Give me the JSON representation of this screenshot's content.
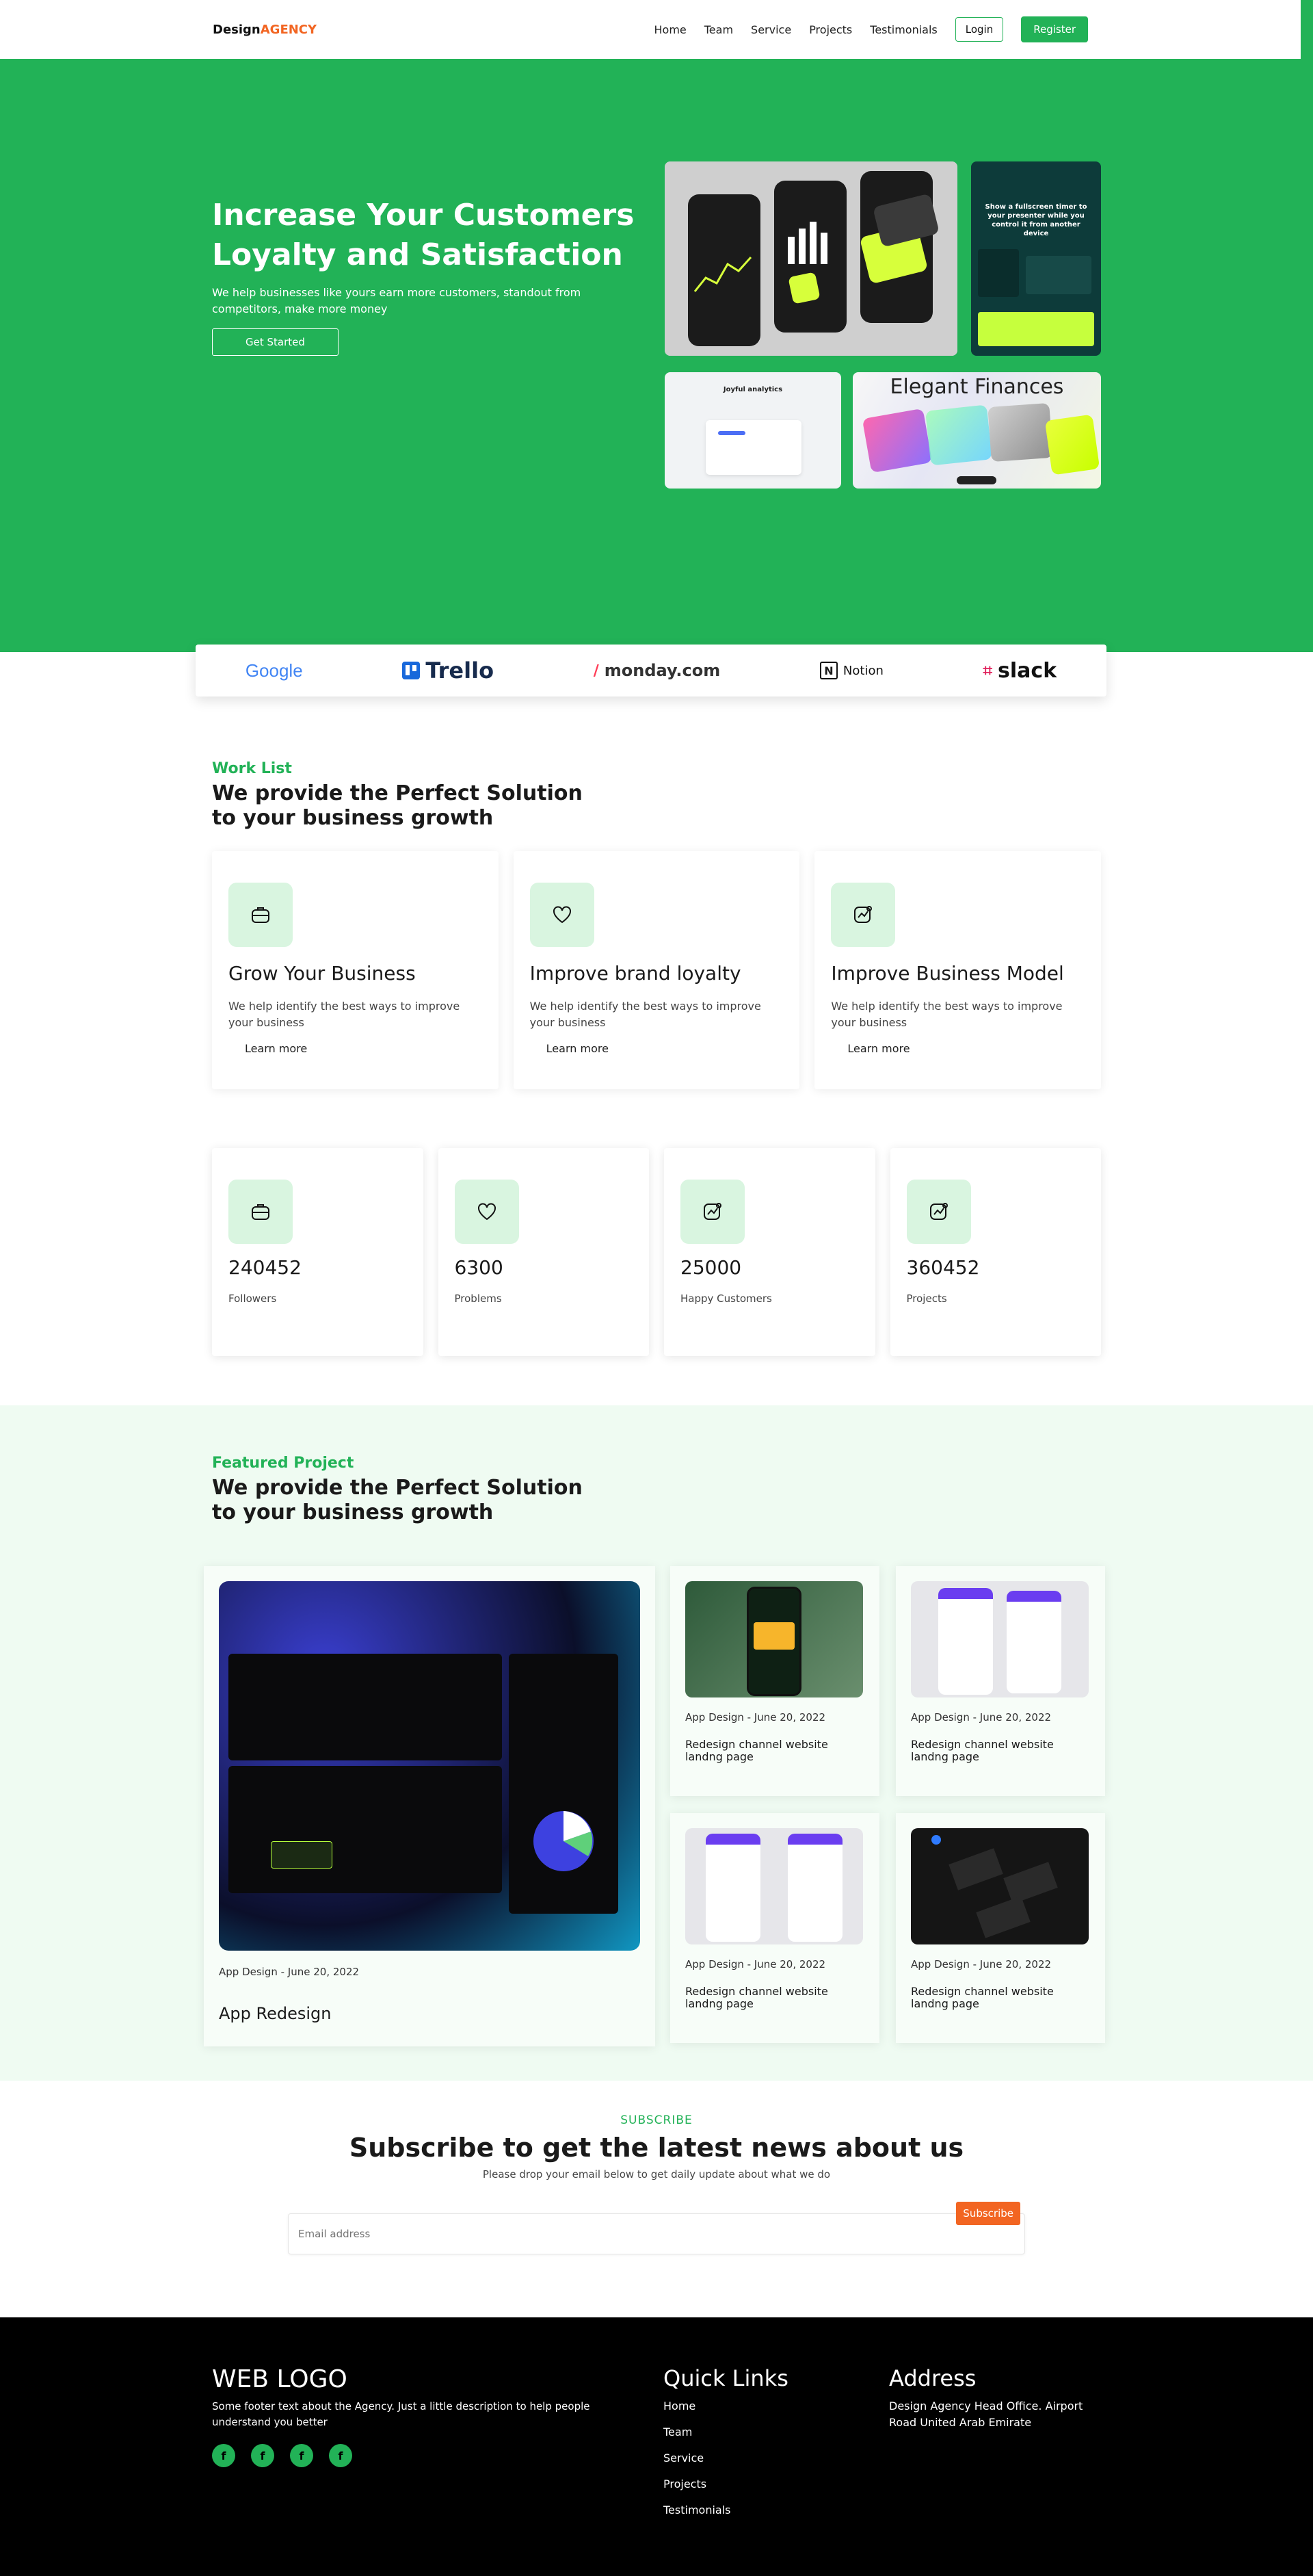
{
  "nav": {
    "logo_main": "Design",
    "logo_accent": "AGENCY",
    "links": [
      "Home",
      "Team",
      "Service",
      "Projects",
      "Testimonials"
    ],
    "login": "Login",
    "register": "Register"
  },
  "hero": {
    "title_line1": "Increase Your Customers",
    "title_line2": "Loyalty and Satisfaction",
    "subtitle": "We help businesses like yours earn more customers, standout from competitors, make more money",
    "cta": "Get Started",
    "gallery_text": {
      "g2_headline": "Show a fullscreen timer to your presenter while you control it from another device",
      "g3_headline": "Joyful analytics",
      "g4_headline": "Elegant Finances"
    }
  },
  "brands": [
    "Google",
    "Trello",
    "monday.com",
    "Notion",
    "slack"
  ],
  "worklist": {
    "eyebrow": "Work List",
    "title": "We provide the Perfect Solution to your business growth",
    "cards": [
      {
        "title": "Grow Your Business",
        "text": "We help identify the best ways to improve your business",
        "link": "Learn more"
      },
      {
        "title": "Improve brand loyalty",
        "text": "We help identify the best ways to improve your business",
        "link": "Learn more"
      },
      {
        "title": "Improve Business Model",
        "text": "We help identify the best ways to improve your business",
        "link": "Learn more"
      }
    ]
  },
  "stats": [
    {
      "value": "240452",
      "label": "Followers"
    },
    {
      "value": "6300",
      "label": "Problems"
    },
    {
      "value": "25000",
      "label": "Happy Customers"
    },
    {
      "value": "360452",
      "label": "Projects"
    }
  ],
  "featured": {
    "eyebrow": "Featured Project",
    "title": "We provide the Perfect Solution to your business growth",
    "big": {
      "meta": "App Design - June 20, 2022",
      "title": "App Redesign"
    },
    "small": [
      {
        "meta": "App Design - June 20, 2022",
        "title": "Redesign channel website landng page"
      },
      {
        "meta": "App Design - June 20, 2022",
        "title": "Redesign channel website landng page"
      },
      {
        "meta": "App Design - June 20, 2022",
        "title": "Redesign channel website landng page"
      },
      {
        "meta": "App Design - June 20, 2022",
        "title": "Redesign channel website landng page"
      }
    ]
  },
  "subscribe": {
    "eyebrow": "SUBSCRIBE",
    "title": "Subscribe to get the latest news about us",
    "text": "Please drop your email below to get daily update about what we do",
    "placeholder": "Email address",
    "button": "Subscribe"
  },
  "footer": {
    "logo": "WEB LOGO",
    "text": "Some footer text about the Agency. Just a little description to help people understand you better",
    "social_glyph": "f",
    "quick_links_title": "Quick Links",
    "quick_links": [
      "Home",
      "Team",
      "Service",
      "Projects",
      "Testimonials"
    ],
    "address_title": "Address",
    "address": "Design Agency Head Office. Airport Road United Arab Emirate"
  },
  "colors": {
    "brand_green": "#22b257",
    "accent_orange": "#f26522",
    "soft_green": "#d9f5e0",
    "footer_bg": "#000000"
  }
}
